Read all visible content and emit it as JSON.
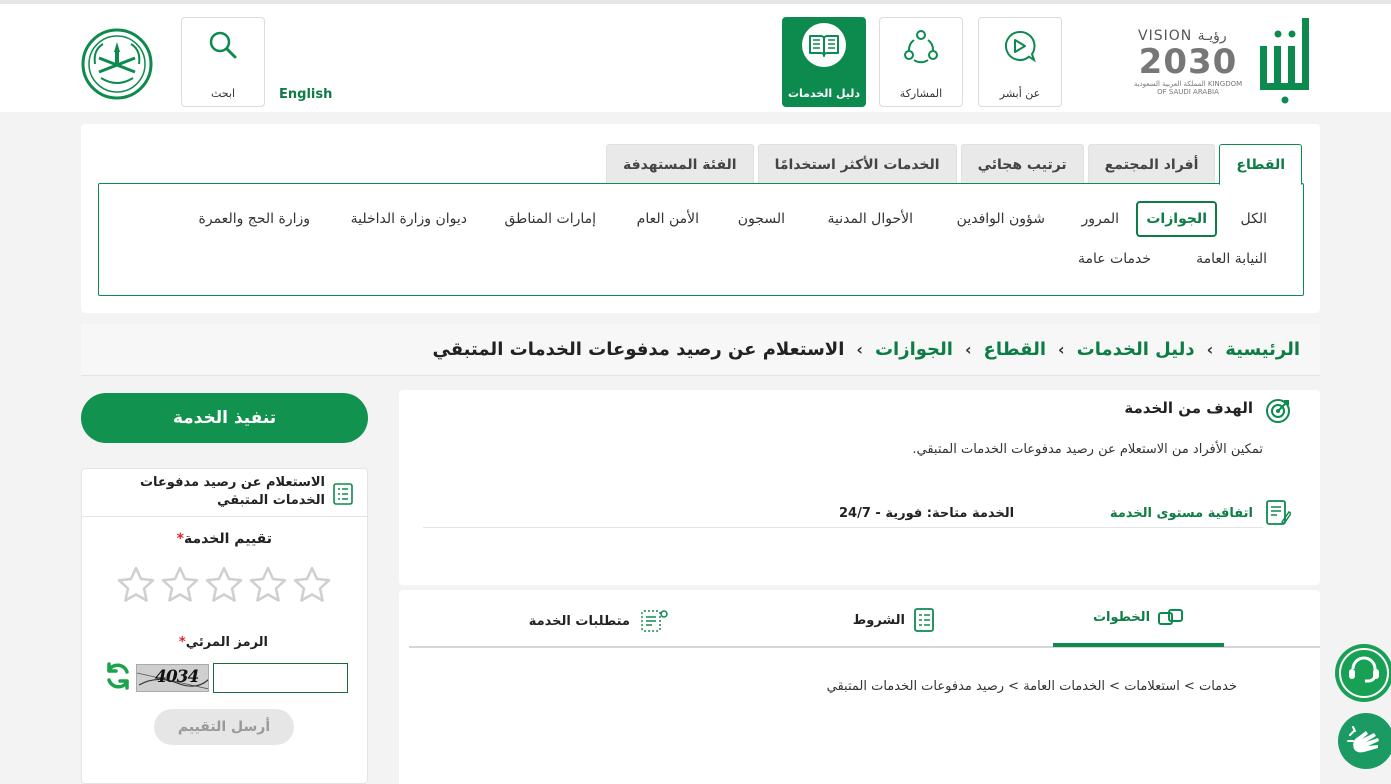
{
  "header": {
    "nav": {
      "about_absher": "عن أبشر",
      "participation": "المشاركة",
      "services_guide": "دليل الخدمات",
      "search": "ابحث"
    },
    "english_link": "English",
    "vision": {
      "line1": "VISION رؤيـة",
      "line2": "2030",
      "line3": "المملكة العربية السعودية KINGDOM OF SAUDI ARABIA"
    }
  },
  "sector_tabs": [
    "القطاع",
    "أفراد المجتمع",
    "ترتيب هجائي",
    "الخدمات الأكثر استخدامًا",
    "الفئة المستهدفة"
  ],
  "sector_chips": {
    "row1": [
      "الكل",
      "الجوازات",
      "المرور",
      "شؤون الوافدين",
      "الأحوال المدنية",
      "السجون",
      "الأمن العام",
      "إمارات المناطق",
      "ديوان وزارة الداخلية",
      "وزارة الحج والعمرة"
    ],
    "row2": [
      "النيابة العامة",
      "خدمات عامة"
    ]
  },
  "breadcrumb": {
    "home": "الرئيسية",
    "guide": "دليل الخدمات",
    "sector": "القطاع",
    "passports": "الجوازات",
    "current": "الاستعلام عن رصيد مدفوعات الخدمات المتبقي",
    "sep": "›"
  },
  "goal": {
    "title": "الهدف من الخدمة",
    "description": "تمكين الأفراد من الاستعلام عن رصيد مدفوعات الخدمات المتبقي.",
    "sla_label": "اتفاقية مستوى الخدمة",
    "sla_value": "الخدمة متاحة: فورية - 24/7"
  },
  "steps": {
    "tabs": {
      "steps": "الخطوات",
      "terms": "الشروط",
      "requirements": "متطلبات الخدمة"
    },
    "path": "خدمات > استعلامات > الخدمات العامة > رصيد مدفوعات الخدمات المتبقي"
  },
  "sidebar": {
    "execute_button": "تنفيذ الخدمة",
    "card_title": "الاستعلام عن رصيد مدفوعات الخدمات المتبقي",
    "rating_label": "تقييم الخدمة",
    "required_mark": "*",
    "captcha_label": "الرمز المرئي",
    "captcha_text": "4034",
    "captcha_value": "",
    "submit_rating": "أرسل التقييم"
  },
  "colors": {
    "primary": "#0d8a4e",
    "primary_text": "#0d7d45",
    "required": "#d9262c"
  }
}
